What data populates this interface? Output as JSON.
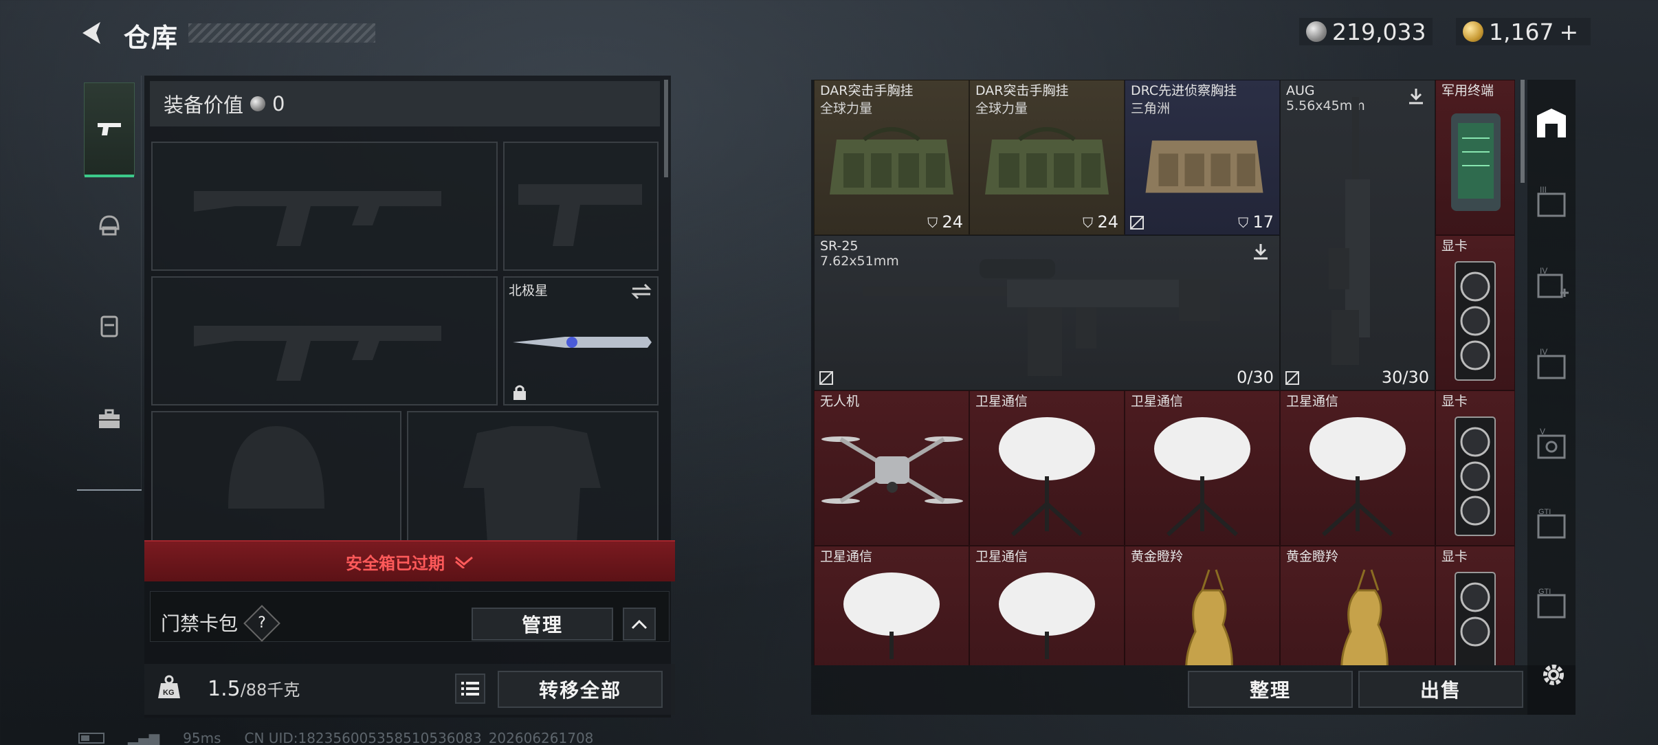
{
  "header": {
    "title": "仓库",
    "currency_silver": "219,033",
    "currency_gold": "1,167",
    "add_symbol": "+"
  },
  "loadout": {
    "value_label": "装备价值",
    "value": "0",
    "melee_name": "北极星",
    "safe_box_status": "安全箱已过期",
    "keycard_label": "门禁卡包",
    "help": "?",
    "manage_label": "管理",
    "weight_current": "1.5",
    "weight_max": "/88千克",
    "transfer_all_label": "转移全部"
  },
  "stash": {
    "items": [
      {
        "name": "DAR突击手胸挂",
        "sub": "全球力量",
        "count": "24"
      },
      {
        "name": "DAR突击手胸挂",
        "sub": "全球力量",
        "count": "24"
      },
      {
        "name": "DRC先进侦察胸挂",
        "sub": "三角洲",
        "count": "17"
      },
      {
        "name": "AUG",
        "sub": "5.56x45mm",
        "count": "30/30"
      },
      {
        "name": "军用终端"
      },
      {
        "name": "SR-25",
        "sub": "7.62x51mm",
        "count": "0/30"
      },
      {
        "name": "显卡"
      },
      {
        "name": "无人机"
      },
      {
        "name": "卫星通信"
      },
      {
        "name": "卫星通信"
      },
      {
        "name": "卫星通信"
      },
      {
        "name": "显卡"
      },
      {
        "name": "卫星通信"
      },
      {
        "name": "卫星通信"
      },
      {
        "name": "黄金瞪羚"
      },
      {
        "name": "黄金瞪羚"
      },
      {
        "name": "显卡"
      }
    ],
    "sort_label": "整理",
    "sell_label": "出售"
  },
  "footer": {
    "ping": "95ms",
    "uid": "CN UID:182356005358510536083_202606261708"
  },
  "colors": {
    "accent_green": "#3cc98a",
    "expired_red": "#ff5a5a",
    "item_red": "#4c1c20"
  }
}
